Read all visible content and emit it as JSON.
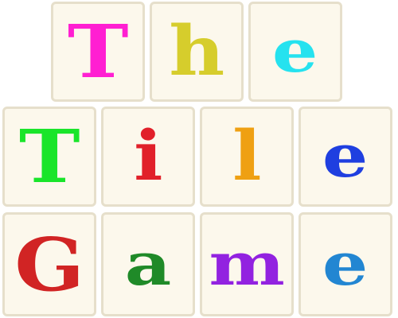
{
  "title_rows": [
    {
      "word": "The",
      "tiles": [
        {
          "letter": "T",
          "color": "#ff1fd2"
        },
        {
          "letter": "h",
          "color": "#d6cd2c"
        },
        {
          "letter": "e",
          "color": "#25e2ef"
        }
      ]
    },
    {
      "word": "Tile",
      "tiles": [
        {
          "letter": "T",
          "color": "#19e52a"
        },
        {
          "letter": "i",
          "color": "#e1202a"
        },
        {
          "letter": "l",
          "color": "#efa012"
        },
        {
          "letter": "e",
          "color": "#1f3fe0"
        }
      ]
    },
    {
      "word": "Game",
      "tiles": [
        {
          "letter": "G",
          "color": "#d12424"
        },
        {
          "letter": "a",
          "color": "#1f8a28"
        },
        {
          "letter": "m",
          "color": "#9222e0"
        },
        {
          "letter": "e",
          "color": "#2286d2"
        }
      ]
    }
  ],
  "colors": {
    "tile_face": "#fcf8ec",
    "tile_border": "#e6dfcb",
    "background": "#ffffff"
  }
}
